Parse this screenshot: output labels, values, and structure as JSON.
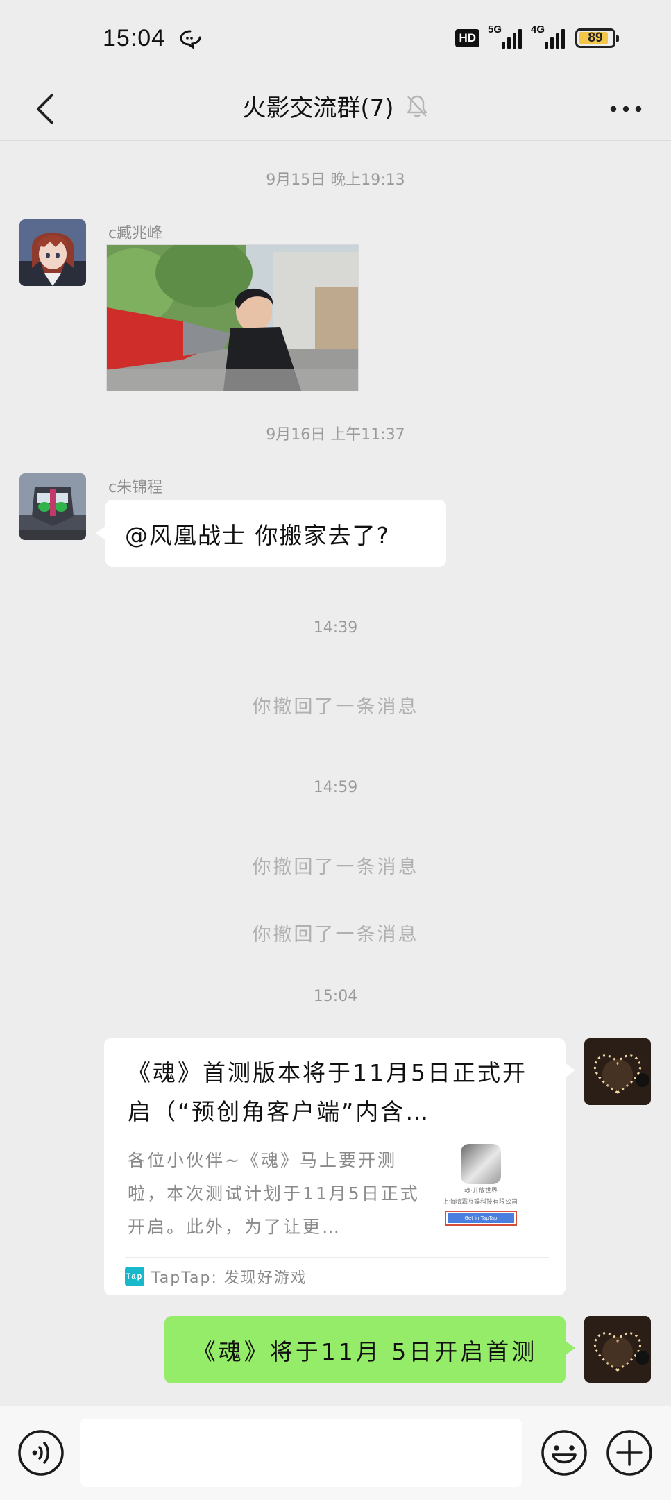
{
  "status_bar": {
    "time": "15:04",
    "hd": "HD",
    "net1": "5G",
    "net2": "4G",
    "battery": "89",
    "battery_level": 0.89
  },
  "header": {
    "title": "火影交流群(7)",
    "muted": true
  },
  "messages": {
    "ts1": "9月15日 晚上19:13",
    "sender1": "c臧兆峰",
    "ts2": "9月16日 上午11:37",
    "sender2": "c朱锦程",
    "text2": "@风凰战士  你搬家去了?",
    "ts3": "14:39",
    "recall1": "你撤回了一条消息",
    "ts4": "14:59",
    "recall2": "你撤回了一条消息",
    "recall3": "你撤回了一条消息",
    "ts5": "15:04"
  },
  "card": {
    "title": "《魂》首测版本将于11月5日正式开启（“预创角客户端”内含…",
    "description": "各位小伙伴~《魂》马上要开测啦，本次测试计划于11月5日正式开启。此外，为了让更…",
    "thumb_caption": "魂·开放世界",
    "thumb_company": "上海晴霜互娱科技有限公司 for iOS",
    "thumb_button": "Get in TapTap",
    "source_logo": "Tap",
    "source": "TapTap: 发现好游戏"
  },
  "outgoing": {
    "text": "《魂》将于11月 5日开启首测"
  },
  "input": {
    "value": ""
  },
  "colors": {
    "background": "#ededed",
    "outgoing_bubble": "#95ec69",
    "incoming_bubble": "#ffffff",
    "battery": "#f3c64a",
    "taptap": "#16b8c9"
  }
}
